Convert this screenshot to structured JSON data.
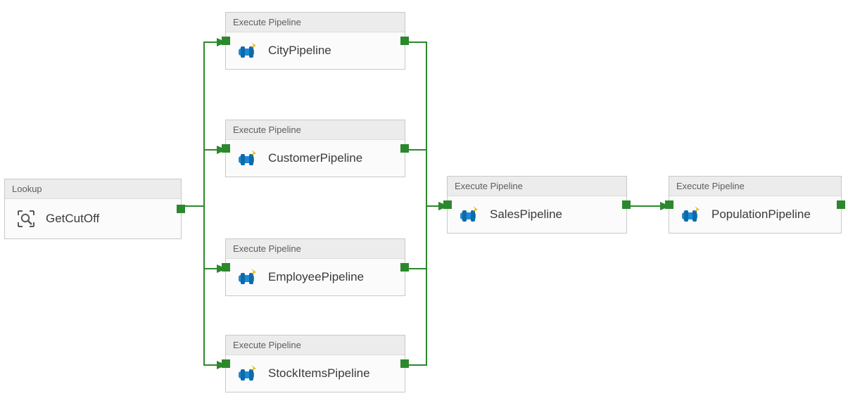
{
  "activities": {
    "getCutOff": {
      "type": "Lookup",
      "name": "GetCutOff"
    },
    "city": {
      "type": "Execute Pipeline",
      "name": "CityPipeline"
    },
    "customer": {
      "type": "Execute Pipeline",
      "name": "CustomerPipeline"
    },
    "employee": {
      "type": "Execute Pipeline",
      "name": "EmployeePipeline"
    },
    "stock": {
      "type": "Execute Pipeline",
      "name": "StockItemsPipeline"
    },
    "sales": {
      "type": "Execute Pipeline",
      "name": "SalesPipeline"
    },
    "population": {
      "type": "Execute Pipeline",
      "name": "PopulationPipeline"
    }
  }
}
